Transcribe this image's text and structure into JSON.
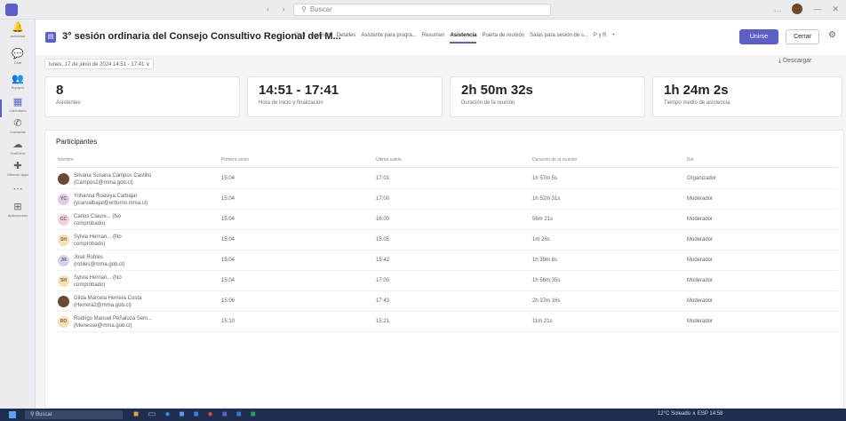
{
  "titlebar": {
    "nav": "‹ ›",
    "search_placeholder": "Buscar",
    "more": "…",
    "min": "—",
    "close": "✕"
  },
  "rail": [
    {
      "label": "Actividad",
      "icon": "bell-icon",
      "glyph": "🔔"
    },
    {
      "label": "Chat",
      "icon": "chat-icon",
      "glyph": "💬"
    },
    {
      "label": "Equipos",
      "icon": "teams-icon",
      "glyph": "👥"
    },
    {
      "label": "Calendario",
      "icon": "calendar-icon",
      "glyph": "▦"
    },
    {
      "label": "Llamadas",
      "icon": "phone-icon",
      "glyph": "✆"
    },
    {
      "label": "OneDrive",
      "icon": "cloud-icon",
      "glyph": "☁"
    },
    {
      "label": "Obtener apps",
      "icon": "apps-icon",
      "glyph": "✚"
    },
    {
      "label": "",
      "icon": "more-icon",
      "glyph": "⋯"
    },
    {
      "label": "Aplicaciones",
      "icon": "grid-icon",
      "glyph": "⊞"
    }
  ],
  "header": {
    "title": "3° sesión ordinaria del Consejo Consultivo Regional del M...",
    "tabs": [
      "Chat",
      "Archivos",
      "Detalles",
      "Asistente para progra...",
      "Resumen",
      "Asistencia",
      "Puerta de reunión",
      "Salas para sesión de s...",
      "P y R",
      "+"
    ],
    "active_tab": "Asistencia",
    "join": "Unirse",
    "close": "Cerrar"
  },
  "date_selector": "lunes, 17 de junio de 2024 14:51 - 17:41 ∨",
  "download": "⤓ Descargar",
  "stats": [
    {
      "value": "8",
      "unit_parts": [],
      "label": "Asistentes"
    },
    {
      "value": "14:51 - 17:41",
      "unit_parts": [],
      "label": "Hora de inicio y finalización"
    },
    {
      "value": "2h 50m 32s",
      "unit_parts": [],
      "label": "Duración de la reunión"
    },
    {
      "value": "1h 24m 2s",
      "unit_parts": [],
      "label": "Tiempo medio de asistencia"
    }
  ],
  "participants": {
    "title": "Participantes",
    "columns": [
      "Nombre",
      "Primera unión",
      "Última salida",
      "Duración de la reunión",
      "Rol"
    ],
    "rows": [
      {
        "initials": "",
        "photo": true,
        "name1": "Silvana Susana Campos Castillo",
        "name2": "(Campos2@mma.gob.cl)",
        "first": "15:04",
        "last": "17:01",
        "duration": "1h 57m 5s",
        "role": "Organizador"
      },
      {
        "initials": "YC",
        "photo": false,
        "color": "#e8c8e8",
        "name1": "Yohanna Roasiya Carbajal",
        "name2": "(ycarvalbajal@entorno.mma.cl)",
        "first": "15:04",
        "last": "17:00",
        "duration": "1h 52m 31s",
        "role": "Moderador"
      },
      {
        "initials": "CC",
        "photo": false,
        "color": "#f6d0d8",
        "name1": "Carlos Claure... (No",
        "name2": "comprobado)",
        "first": "15:04",
        "last": "16:00",
        "duration": "56m 21s",
        "role": "Moderador"
      },
      {
        "initials": "SH",
        "photo": false,
        "color": "#f8e1b0",
        "name1": "Sylvia Hernan... (No",
        "name2": "comprobado)",
        "first": "15:04",
        "last": "15:05",
        "duration": "1m 26s",
        "role": "Moderador"
      },
      {
        "initials": "JR",
        "photo": false,
        "color": "#d8d0f0",
        "name1": "José Robles",
        "name2": "(robles@mma.gob.cl)",
        "first": "15:04",
        "last": "15:42",
        "duration": "1h 39m 8s",
        "role": "Moderador"
      },
      {
        "initials": "SH",
        "photo": false,
        "color": "#f8e1b0",
        "name1": "Sylvia Hernan... (No",
        "name2": "comprobado)",
        "first": "15:04",
        "last": "17:00",
        "duration": "1h 56m 35s",
        "role": "Moderador"
      },
      {
        "initials": "",
        "photo": true,
        "name1": "Gilda Marcela Herrera Costa",
        "name2": "(Herrera2@mma.gob.cl)",
        "first": "15:06",
        "last": "17:43",
        "duration": "2h 37m 16s",
        "role": "Moderador"
      },
      {
        "initials": "RO",
        "photo": false,
        "color": "#f8e1b0",
        "name1": "Rodrigo Manuel Peñaloza Sem...",
        "name2": "(Menesse@mma.gob.cl)",
        "first": "15:10",
        "last": "15:21",
        "duration": "11m 21s",
        "role": "Moderador"
      }
    ]
  },
  "taskbar": {
    "search": "Buscar",
    "tray": "12°C Soleado   ∧  ESP  14:58"
  }
}
